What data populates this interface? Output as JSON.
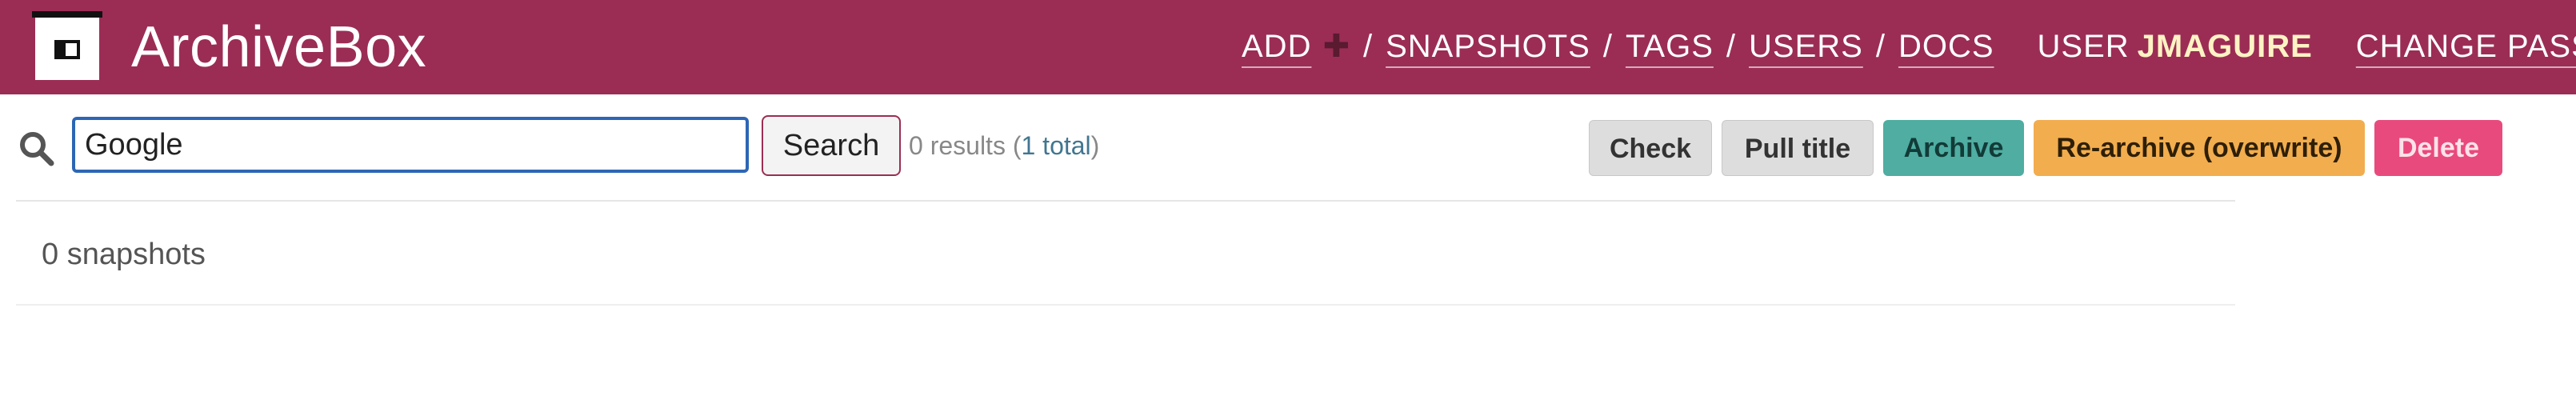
{
  "header": {
    "brand": "ArchiveBox",
    "nav": {
      "add": "ADD",
      "add_icon": "plus",
      "separator": "/",
      "snapshots": "SNAPSHOTS",
      "tags": "TAGS",
      "users": "USERS",
      "docs": "DOCS",
      "user_prefix": "USER",
      "username": "JMAGUIRE",
      "change_password": "CHANGE PASSWORD"
    }
  },
  "search": {
    "icon": "search-icon",
    "value": "Google",
    "button_label": "Search",
    "results_prefix": "0 results (",
    "results_total": "1 total",
    "results_suffix": ")"
  },
  "actions": {
    "check": "Check",
    "pull_title": "Pull title",
    "archive": "Archive",
    "rearchive": "Re-archive (overwrite)",
    "delete": "Delete"
  },
  "list": {
    "count_text": "0 snapshots"
  },
  "colors": {
    "header_bg": "#9b2d55",
    "archive_btn": "#4fada2",
    "rearchive_btn": "#f2ad4e",
    "delete_btn": "#e94a7d",
    "input_border": "#2d66b5"
  }
}
